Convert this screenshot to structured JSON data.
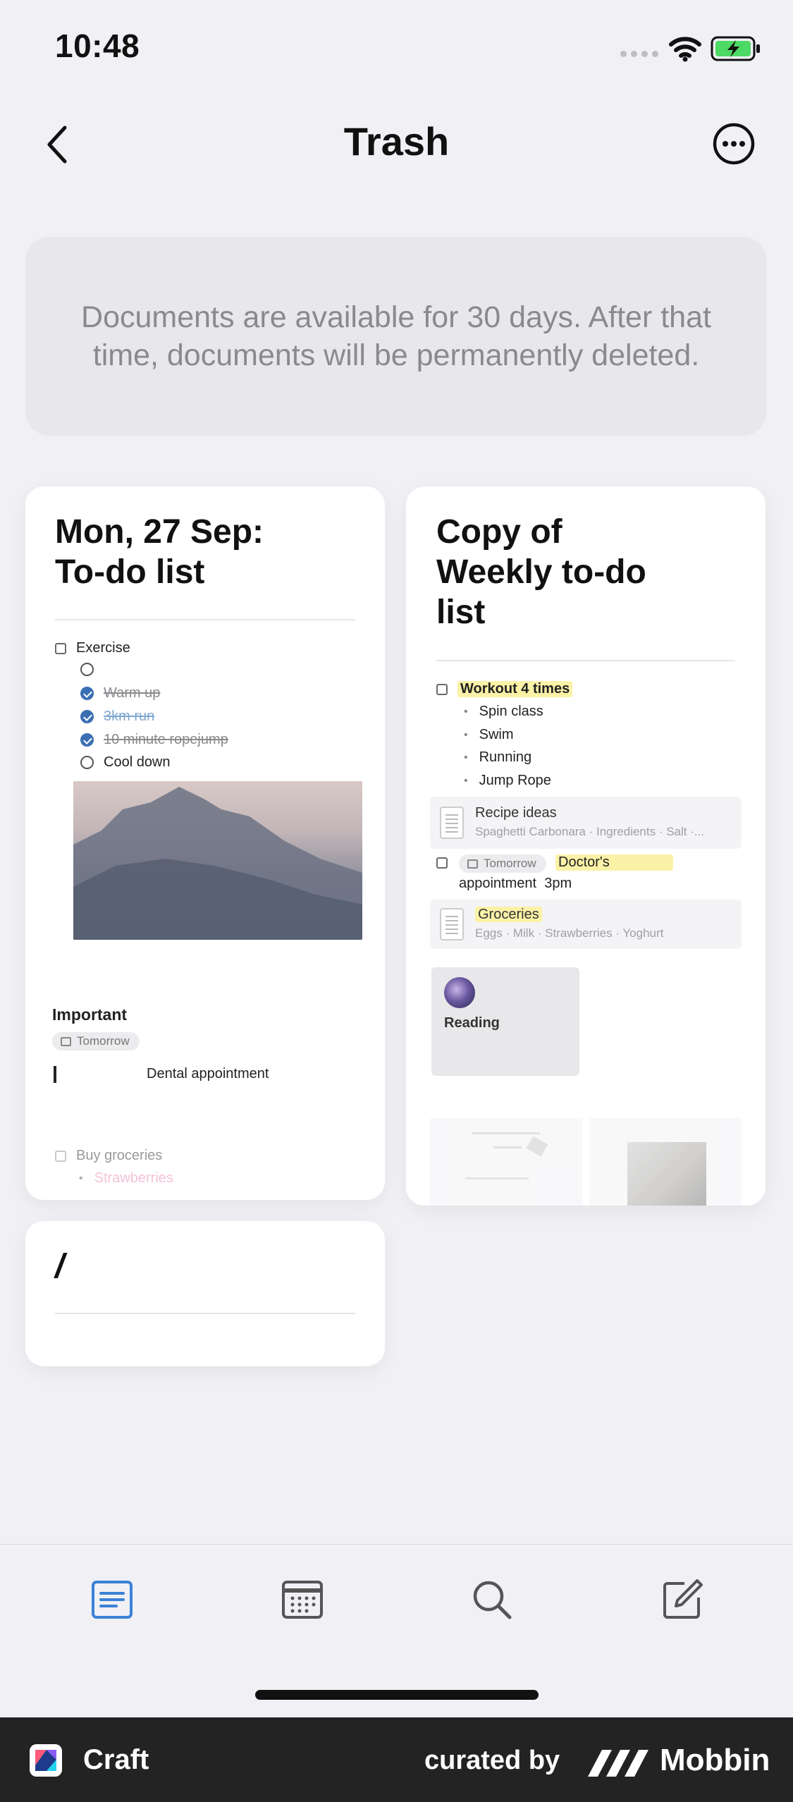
{
  "status_bar": {
    "time": "10:48"
  },
  "nav": {
    "title": "Trash"
  },
  "info": {
    "text": "Documents are available for 30 days. After that time, documents will be permanently deleted."
  },
  "card1": {
    "title_line1": "Mon, 27 Sep:",
    "title_line2": "To-do list",
    "exercise": "Exercise",
    "warm_up": "Warm up",
    "run": "3km run",
    "ropejump": "10 minute ropejump",
    "cool_down": "Cool down",
    "important": "Important",
    "tomorrow": "Tomorrow",
    "dental": "Dental appointment",
    "buy_groceries": "Buy groceries",
    "strawberries": "Strawberries"
  },
  "card2": {
    "title_line1": "Copy of",
    "title_line2": "Weekly to-do",
    "title_line3": "list",
    "workout": "Workout 4 times",
    "items": [
      "Spin class",
      "Swim",
      "Running",
      "Jump Rope"
    ],
    "recipe_title": "Recipe ideas",
    "recipe_sub": "Spaghetti Carbonara · Ingredients · Salt ·...",
    "tomorrow": "Tomorrow",
    "doctors": "Doctor's",
    "appointment": "appointment",
    "time": "3pm",
    "groceries_title": "Groceries",
    "groceries_sub": "Eggs · Milk · Strawberries · Yoghurt",
    "reading": "Reading"
  },
  "card3": {
    "title": "/"
  },
  "footer": {
    "app_name": "Craft",
    "curated_by": "curated by",
    "brand": "Mobbin"
  },
  "icons": {
    "back": "chevron-left-icon",
    "more": "ellipsis-circle-icon",
    "tab_documents": "documents-icon",
    "tab_calendar": "calendar-icon",
    "tab_search": "search-icon",
    "tab_new": "compose-icon"
  },
  "colors": {
    "accent": "#3b82d6",
    "highlight": "#fbf2a7"
  }
}
